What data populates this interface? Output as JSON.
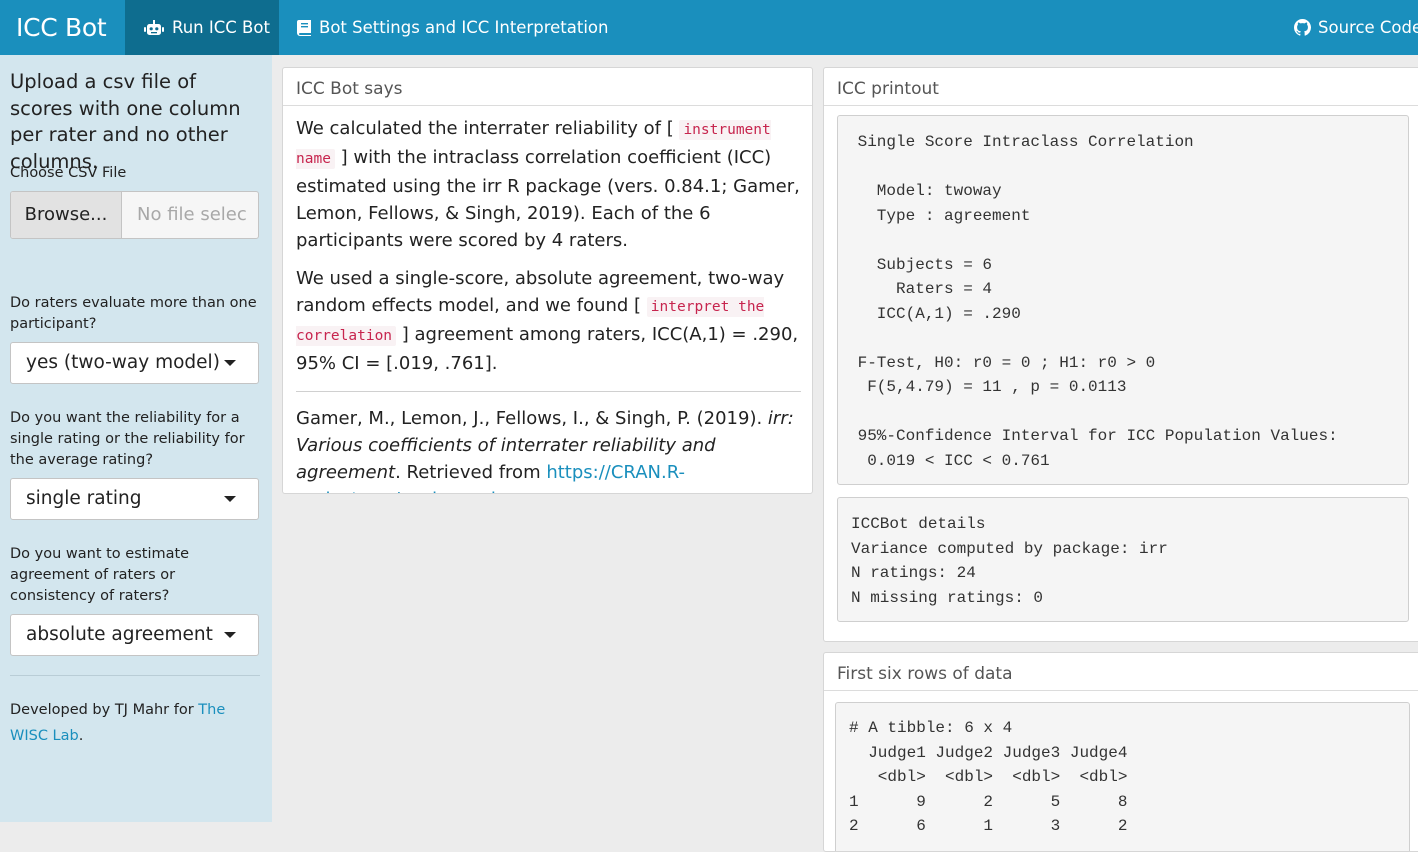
{
  "navbar": {
    "brand": "ICC Bot",
    "tabs": [
      {
        "label": "Run ICC Bot",
        "icon": "robot-icon",
        "active": true
      },
      {
        "label": "Bot Settings and ICC Interpretation",
        "icon": "book-icon",
        "active": false
      }
    ],
    "source_link": {
      "label": "Source Code",
      "icon": "github-icon"
    }
  },
  "sidebar": {
    "intro": "Upload a csv file of scores with one column per rater and no other columns.",
    "file_label": "Choose CSV File",
    "browse_label": "Browse...",
    "file_placeholder": "No file selec",
    "q_twoway": "Do raters evaluate more than one participant?",
    "twoway_value": "yes (two-way model)",
    "q_unit": "Do you want the reliability for a single rating or the reliability for the average rating?",
    "unit_value": "single rating",
    "q_type": "Do you want to estimate agreement of raters or consistency of raters?",
    "type_value": "absolute agreement",
    "dev_text": "Developed by TJ Mahr for ",
    "dev_link": "The WISC Lab",
    "dev_end": "."
  },
  "says": {
    "heading": "ICC Bot says",
    "p1_a": "We calculated the interrater reliability of [ ",
    "p1_code": "instrument name",
    "p1_b": " ] with the intraclass correlation coefficient (ICC) estimated using the irr R package (vers. 0.84.1; Gamer, Lemon, Fellows, & Singh, 2019). Each of the 6 participants were scored by 4 raters.",
    "p2_a": "We used a single-score, absolute agreement, two-way random effects model, and we found [ ",
    "p2_code": "interpret the correlation",
    "p2_b": " ] agreement among raters, ICC(A,1) = .290, 95% CI = [.019, .761].",
    "ref_a": "Gamer, M., Lemon, J., Fellows, I., & Singh, P. (2019). ",
    "ref_title": "irr: Various coefficients of interrater reliability and agreement",
    "ref_b": ". Retrieved from ",
    "ref_link": "https://CRAN.R-project.org/package=irr"
  },
  "printout": {
    "heading": "ICC printout",
    "icc_text": " Single Score Intraclass Correlation\n\n   Model: twoway \n   Type : agreement \n\n   Subjects = 6 \n     Raters = 4 \n   ICC(A,1) = .290\n\n F-Test, H0: r0 = 0 ; H1: r0 > 0 \n  F(5,4.79) = 11 , p = 0.0113 \n\n 95%-Confidence Interval for ICC Population Values:\n  0.019 < ICC < 0.761",
    "details_text": "ICCBot details\nVariance computed by package: irr\nN ratings: 24\nN missing ratings: 0"
  },
  "data_panel": {
    "heading": "First six rows of data",
    "tibble_text": "# A tibble: 6 x 4\n  Judge1 Judge2 Judge3 Judge4\n   <dbl>  <dbl>  <dbl>  <dbl>\n1      9      2      5      8\n2      6      1      3      2"
  }
}
